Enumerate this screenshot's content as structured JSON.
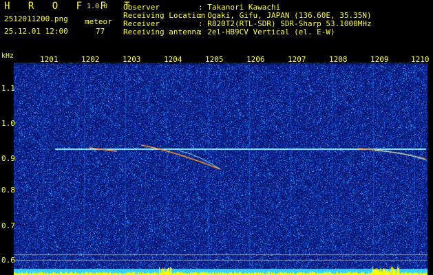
{
  "header": {
    "app_title": "H R O F F T",
    "version": "1.0.0",
    "filename": "2512011200.png",
    "datetime": "25.12.01 12:00",
    "meteor_label": "meteor",
    "meteor_count": "77"
  },
  "info": [
    {
      "label": "Observer",
      "value": ": Takanori Kawachi"
    },
    {
      "label": "Receiving Location",
      "value": ": Ogaki, Gifu, JAPAN (136.60E, 35.35N)"
    },
    {
      "label": "Receiver",
      "value": ": R820T2(RTL-SDR) SDR-Sharp 53.1000MHz"
    },
    {
      "label": "Receiving antenna",
      "value": ": 2el-HB9CV Vertical (el. E-W)"
    }
  ],
  "axes": {
    "y_unit": "kHz",
    "x_ticks": [
      "1201",
      "1202",
      "1203",
      "1204",
      "1205",
      "1206",
      "1207",
      "1208",
      "1209",
      "1210"
    ],
    "y_ticks": [
      "1.1",
      "1.0",
      "0.9",
      "0.8",
      "0.7",
      "0.6"
    ]
  },
  "colors": {
    "text": "#ffff3a",
    "background": "#000000",
    "spectrogram_base": "#0a1f8c",
    "carrier": "#8ef0ff",
    "meteor_echo": "#ff9a2e",
    "activity_bars": "#ffff00",
    "activity_base": "#33d0ff"
  }
}
